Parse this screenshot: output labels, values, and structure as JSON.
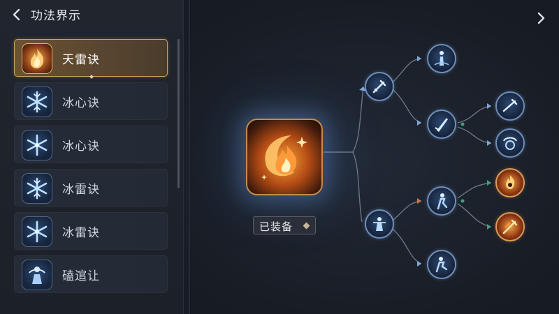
{
  "header": {
    "title": "功法界示"
  },
  "skills": [
    {
      "label": "天雷诀",
      "icon": "fire-icon",
      "selected": true
    },
    {
      "label": "冰心诀",
      "icon": "ice-crystal-icon",
      "selected": false
    },
    {
      "label": "冰心诀",
      "icon": "ice-crystal-icon",
      "selected": false
    },
    {
      "label": "冰雷诀",
      "icon": "ice-crystal-icon",
      "selected": false
    },
    {
      "label": "冰雷诀",
      "icon": "ice-crystal-icon",
      "selected": false
    },
    {
      "label": "磕逭让",
      "icon": "warrior-icon",
      "selected": false
    }
  ],
  "main_skill": {
    "icon": "fire-swirl-icon",
    "status_label": "已装备"
  },
  "tree_nodes": [
    {
      "id": "n1",
      "icon": "sword-icon",
      "element": "ice"
    },
    {
      "id": "n2",
      "icon": "warrior-icon",
      "element": "ice"
    },
    {
      "id": "n3",
      "icon": "figure-icon",
      "element": "ice"
    },
    {
      "id": "n4",
      "icon": "blade-icon",
      "element": "ice"
    },
    {
      "id": "n5",
      "icon": "sword-icon",
      "element": "ice"
    },
    {
      "id": "n6",
      "icon": "shield-icon",
      "element": "ice"
    },
    {
      "id": "n7",
      "icon": "dancer-icon",
      "element": "ice"
    },
    {
      "id": "n8",
      "icon": "dancer-icon",
      "element": "ice"
    },
    {
      "id": "n9",
      "icon": "flame-skull-icon",
      "element": "fire"
    },
    {
      "id": "n10",
      "icon": "flame-sword-icon",
      "element": "fire"
    }
  ],
  "colors": {
    "accent_gold": "#c9a164",
    "ice_blue": "#6f8fb8",
    "fire_orange": "#f1a145",
    "link_green": "#3aa37a"
  }
}
